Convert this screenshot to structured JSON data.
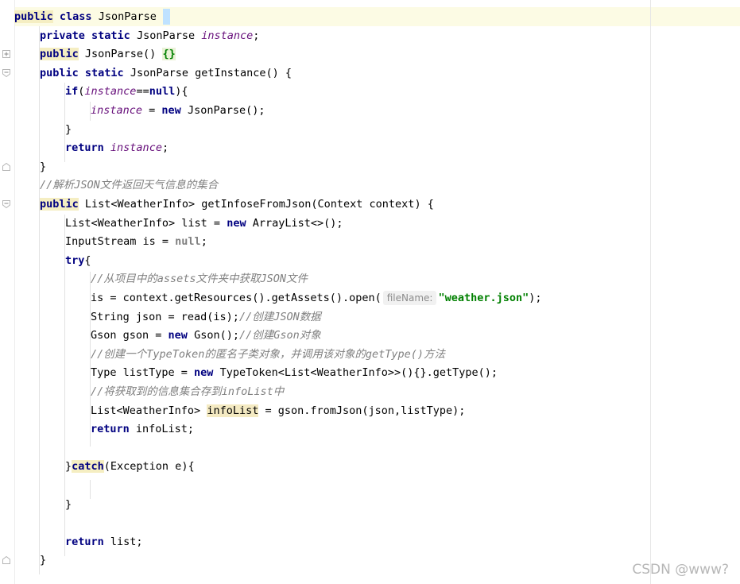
{
  "editor": {
    "lines": [
      {
        "indent": 0,
        "tokens": [
          {
            "t": "public",
            "c": "kw hl-kw"
          },
          {
            "t": " "
          },
          {
            "t": "class",
            "c": "kw"
          },
          {
            "t": " JsonParse "
          },
          {
            "t": "",
            "c": "hl-open"
          }
        ]
      },
      {
        "indent": 1,
        "tokens": [
          {
            "t": "private",
            "c": "kw"
          },
          {
            "t": " "
          },
          {
            "t": "static",
            "c": "kw"
          },
          {
            "t": " JsonParse "
          },
          {
            "t": "instance",
            "c": "fld"
          },
          {
            "t": ";"
          }
        ]
      },
      {
        "indent": 1,
        "tokens": [
          {
            "t": "public",
            "c": "kw hl-kw"
          },
          {
            "t": " JsonParse() "
          },
          {
            "t": "{}",
            "c": "hl-brace"
          }
        ]
      },
      {
        "indent": 1,
        "tokens": [
          {
            "t": "public",
            "c": "kw"
          },
          {
            "t": " "
          },
          {
            "t": "static",
            "c": "kw"
          },
          {
            "t": " JsonParse getInstance() {"
          }
        ]
      },
      {
        "indent": 2,
        "tokens": [
          {
            "t": "if",
            "c": "kw"
          },
          {
            "t": "("
          },
          {
            "t": "instance",
            "c": "fld"
          },
          {
            "t": "=="
          },
          {
            "t": "null",
            "c": "kw"
          },
          {
            "t": "){"
          }
        ]
      },
      {
        "indent": 3,
        "tokens": [
          {
            "t": "instance",
            "c": "fld"
          },
          {
            "t": " = "
          },
          {
            "t": "new",
            "c": "kw"
          },
          {
            "t": " JsonParse();"
          }
        ]
      },
      {
        "indent": 2,
        "tokens": [
          {
            "t": "}"
          }
        ]
      },
      {
        "indent": 2,
        "tokens": [
          {
            "t": "return",
            "c": "kw"
          },
          {
            "t": " "
          },
          {
            "t": "instance",
            "c": "fld"
          },
          {
            "t": ";"
          }
        ]
      },
      {
        "indent": 1,
        "tokens": [
          {
            "t": "}"
          }
        ]
      },
      {
        "indent": 1,
        "tokens": [
          {
            "t": "//解析JSON文件返回天气信息的集合",
            "c": "cm"
          }
        ]
      },
      {
        "indent": 1,
        "tokens": [
          {
            "t": "public",
            "c": "kw hl-kw"
          },
          {
            "t": " List<WeatherInfo> "
          },
          {
            "t": "getInfose",
            "c": ""
          },
          {
            "t": "FromJson(Context context) {"
          }
        ]
      },
      {
        "indent": 2,
        "tokens": [
          {
            "t": "List<WeatherInfo> list = "
          },
          {
            "t": "new",
            "c": "kw"
          },
          {
            "t": " ArrayList<>();"
          }
        ]
      },
      {
        "indent": 2,
        "tokens": [
          {
            "t": "InputStream is = "
          },
          {
            "t": "null",
            "c": "nl"
          },
          {
            "t": ";"
          }
        ]
      },
      {
        "indent": 2,
        "tokens": [
          {
            "t": "try",
            "c": "kw"
          },
          {
            "t": "{"
          }
        ]
      },
      {
        "indent": 3,
        "tokens": [
          {
            "t": "//从项目中的assets文件夹中获取JSON文件",
            "c": "cm"
          }
        ]
      },
      {
        "indent": 3,
        "tokens": [
          {
            "t": "is = context.getResources().getAssets().open("
          },
          {
            "t": "fileName:",
            "c": "hint"
          },
          {
            "t": "\"weather.json\"",
            "c": "str"
          },
          {
            "t": ");"
          }
        ]
      },
      {
        "indent": 3,
        "tokens": [
          {
            "t": "String json = read(is);"
          },
          {
            "t": "//创建JSON数据",
            "c": "cm"
          }
        ]
      },
      {
        "indent": 3,
        "tokens": [
          {
            "t": "Gson gson = "
          },
          {
            "t": "new",
            "c": "kw"
          },
          {
            "t": " Gson();"
          },
          {
            "t": "//创建Gson对象",
            "c": "cm"
          }
        ]
      },
      {
        "indent": 3,
        "tokens": [
          {
            "t": "//创建一个TypeToken的匿名子类对象，并调用该对象的getType()方法",
            "c": "cm"
          }
        ]
      },
      {
        "indent": 3,
        "tokens": [
          {
            "t": "Type listType = "
          },
          {
            "t": "new",
            "c": "kw"
          },
          {
            "t": " TypeToken<List<WeatherInfo>>(){}.getType();"
          }
        ]
      },
      {
        "indent": 3,
        "tokens": [
          {
            "t": "//将获取到的信息集合存到infoList中",
            "c": "cm"
          }
        ]
      },
      {
        "indent": 3,
        "tokens": [
          {
            "t": "List<WeatherInfo> "
          },
          {
            "t": "infoList",
            "c": "hl-id"
          },
          {
            "t": " = gson.fromJson(json,listType);"
          }
        ]
      },
      {
        "indent": 3,
        "tokens": [
          {
            "t": "return",
            "c": "kw"
          },
          {
            "t": " infoList;"
          }
        ]
      },
      {
        "indent": 0,
        "tokens": []
      },
      {
        "indent": 2,
        "tokens": [
          {
            "t": "}"
          },
          {
            "t": "catch",
            "c": "kw hl-kw"
          },
          {
            "t": "(Exception e){"
          }
        ]
      },
      {
        "indent": 0,
        "tokens": []
      },
      {
        "indent": 2,
        "tokens": [
          {
            "t": "}"
          }
        ]
      },
      {
        "indent": 0,
        "tokens": []
      },
      {
        "indent": 2,
        "tokens": [
          {
            "t": "return",
            "c": "kw"
          },
          {
            "t": " list;"
          }
        ]
      },
      {
        "indent": 1,
        "tokens": [
          {
            "t": "}"
          }
        ]
      }
    ],
    "fold_markers": [
      {
        "line": 2,
        "icon": "plus"
      },
      {
        "line": 3,
        "icon": "minus"
      },
      {
        "line": 8,
        "icon": "end"
      },
      {
        "line": 10,
        "icon": "minus"
      },
      {
        "line": 29,
        "icon": "end"
      }
    ]
  },
  "watermark": "CSDN @www?"
}
